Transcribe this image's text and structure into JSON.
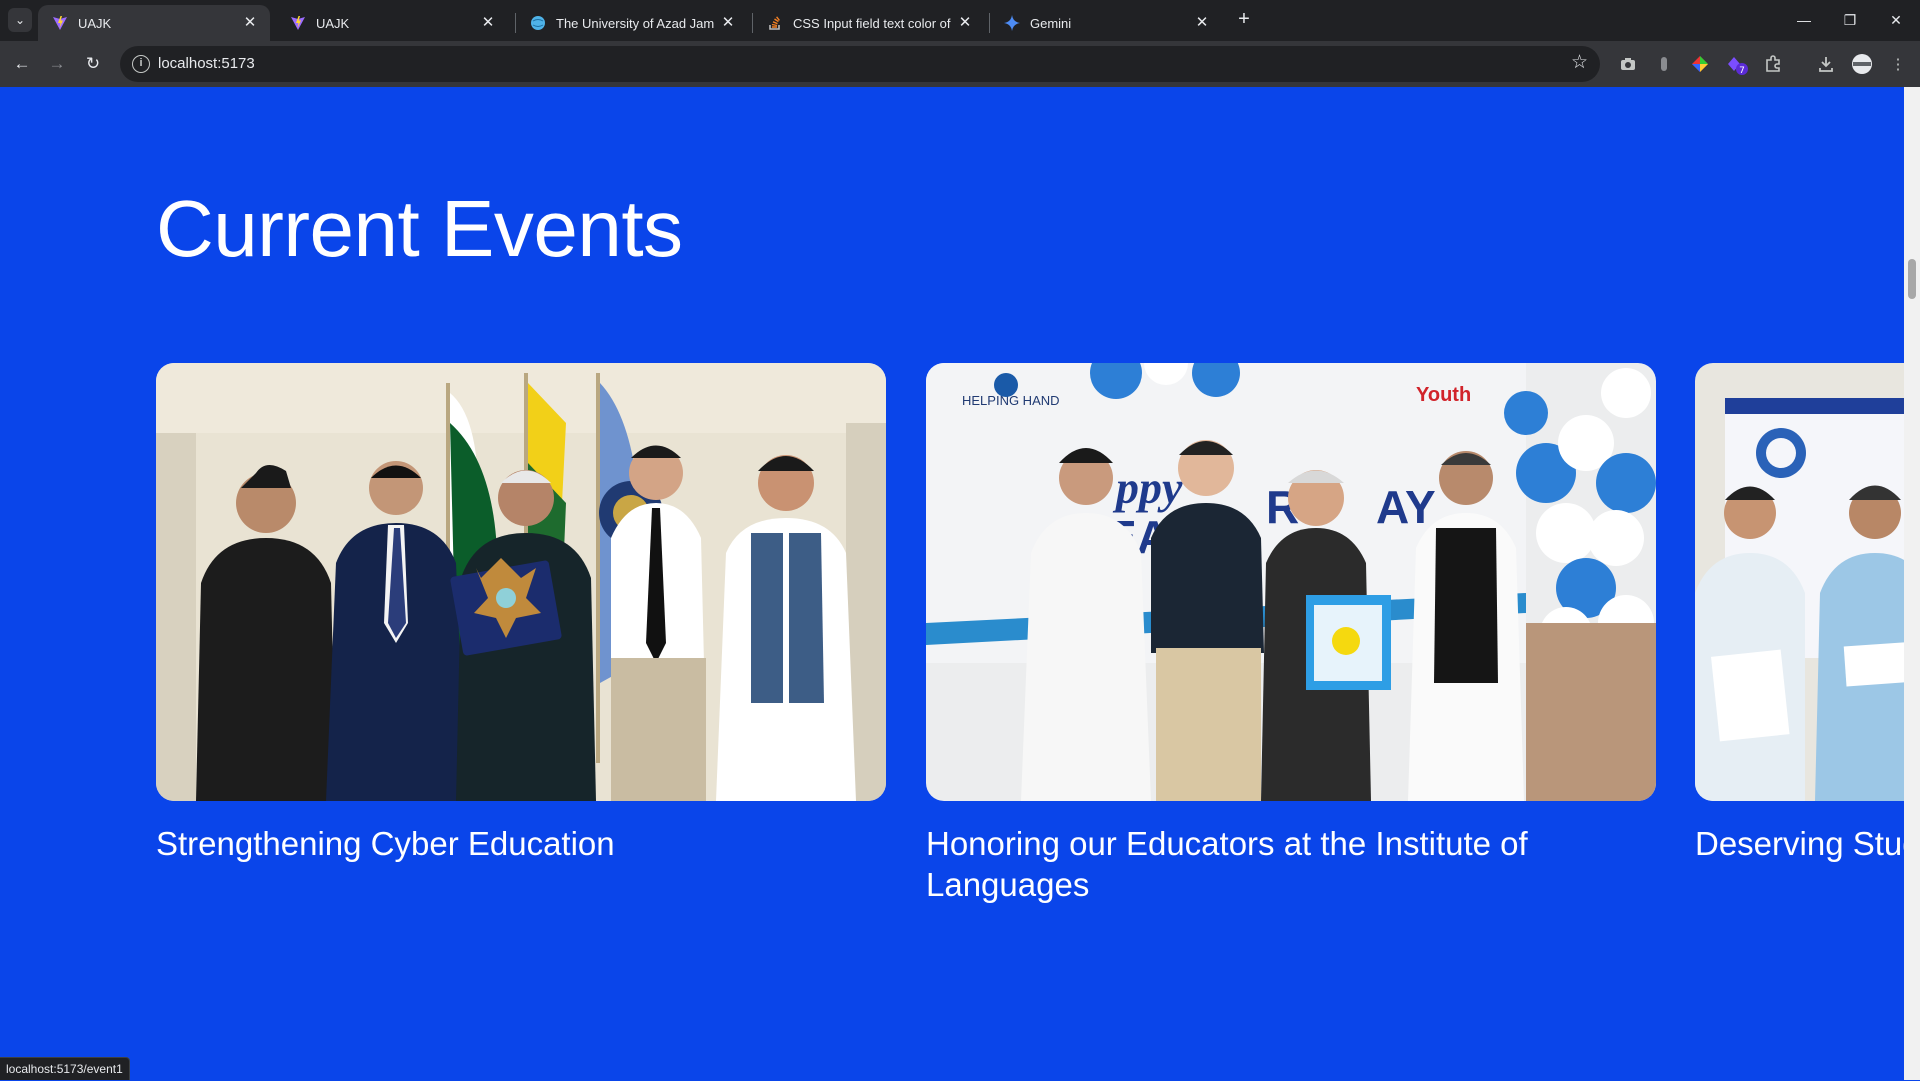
{
  "tabs": [
    {
      "title": "UAJK",
      "icon": "vite-icon",
      "active": true
    },
    {
      "title": "UAJK",
      "icon": "vite-icon",
      "active": false
    },
    {
      "title": "The University of Azad Jammu",
      "icon": "globe-icon",
      "active": false
    },
    {
      "title": "CSS Input field text color of inp",
      "icon": "stackoverflow-icon",
      "active": false
    },
    {
      "title": "Gemini",
      "icon": "gemini-icon",
      "active": false
    }
  ],
  "address_bar": {
    "url": "localhost:5173"
  },
  "page": {
    "heading": "Current Events",
    "events": [
      {
        "caption": "Strengthening Cyber Education",
        "image": "group-photo-award-ceremony"
      },
      {
        "caption": "Honoring our Educators at the Institute of Languages",
        "image": "group-photo-teachers-day",
        "banner_text": [
          "HELPING HAND",
          "Youth",
          "ppy",
          "EAC",
          "RS",
          "AY"
        ]
      },
      {
        "caption": "Deserving Stud Awarded Schol",
        "image": "group-photo-scholarship"
      }
    ]
  },
  "status_bar": {
    "text": "localhost:5173/event1"
  },
  "colors": {
    "page_bg": "#0a45ea",
    "chrome_dark": "#202124",
    "chrome_mid": "#35363a",
    "text_white": "#ffffff"
  }
}
